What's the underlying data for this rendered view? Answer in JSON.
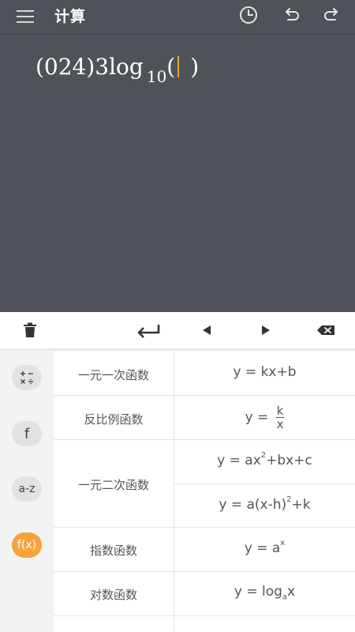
{
  "header": {
    "title": "计算",
    "icons": [
      "menu-icon",
      "history-icon",
      "undo-icon",
      "redo-icon"
    ]
  },
  "display": {
    "expression_before": "(024)3log",
    "expression_subscript": "10",
    "expression_after": "(",
    "expression_close": ")"
  },
  "toolbar": {
    "icons": [
      "trash-icon",
      "enter-icon",
      "left-arrow-icon",
      "right-arrow-icon",
      "backspace-icon"
    ]
  },
  "categories": [
    {
      "label": "+−×÷",
      "icon": "arithmetic-icon",
      "active": false
    },
    {
      "label": "f",
      "icon": "function-icon",
      "active": false
    },
    {
      "label": "a-z",
      "icon": "variables-icon",
      "active": false
    },
    {
      "label": "f(x)",
      "icon": "formula-icon",
      "active": true
    }
  ],
  "functions": [
    {
      "name": "一元一次函数",
      "formula": "y = kx+b"
    },
    {
      "name": "反比例函数",
      "formula_prefix": "y = ",
      "numerator": "k",
      "denominator": "x"
    },
    {
      "name": "一元二次函数",
      "formula1_a": "y = ax",
      "formula1_sup": "2",
      "formula1_b": "+bx+c",
      "formula2_a": "y = a(x-h)",
      "formula2_sup": "2",
      "formula2_b": "+k"
    },
    {
      "name": "指数函数",
      "formula_a": "y = a",
      "formula_sup": "x"
    },
    {
      "name": "对数函数",
      "formula_a": "y = log",
      "formula_sub": "a",
      "formula_b": "x"
    }
  ],
  "colors": {
    "header_bg": "#4f5359",
    "accent": "#f6a33a",
    "caret": "#f0a030"
  }
}
